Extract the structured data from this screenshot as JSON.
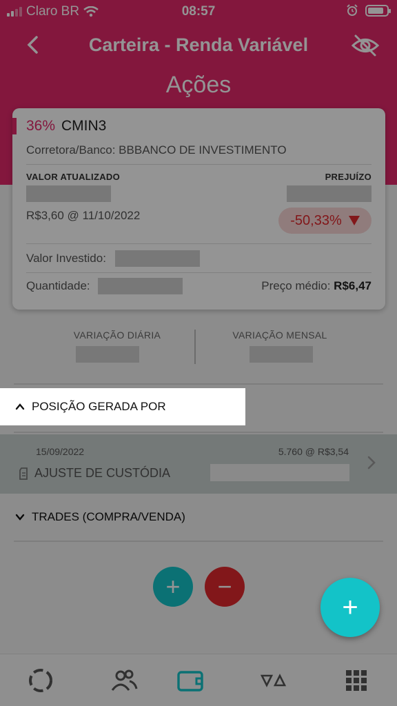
{
  "status_bar": {
    "carrier": "Claro BR",
    "time": "08:57"
  },
  "nav": {
    "title": "Carteira - Renda Variável",
    "back_icon": "chevron-left-icon",
    "visibility_icon": "eye-off-icon"
  },
  "subtitle": "Ações",
  "card": {
    "percent": "36%",
    "ticker": "CMIN3",
    "broker": "Corretora/Banco: BBBANCO DE INVESTIMENTO",
    "valor_atualizado_label": "VALOR ATUALIZADO",
    "prejuizo_label": "PREJUÍZO",
    "price_line": "R$3,60 @ 11/10/2022",
    "change": "-50,33%",
    "valor_investido_label": "Valor Investido:",
    "quantidade_label": "Quantidade:",
    "preco_medio_label": "Preço médio:",
    "preco_medio_value": "R$6,47"
  },
  "variation": {
    "daily_label": "VARIAÇÃO DIÁRIA",
    "monthly_label": "VARIAÇÃO MENSAL"
  },
  "position_section": {
    "title": "POSIÇÃO GERADA POR"
  },
  "trade_row": {
    "date": "15/09/2022",
    "qty_price": "5.760 @ R$3,54",
    "type": "AJUSTE DE CUSTÓDIA"
  },
  "trades_section": {
    "title": "TRADES (COMPRA/VENDA)"
  },
  "actions": {
    "add": "+",
    "remove": "−",
    "fab": "+"
  },
  "colors": {
    "brand": "#e2286a",
    "teal": "#13c3c8",
    "red": "#e0292d"
  },
  "tabbar": {
    "icons": [
      "loading-ring-icon",
      "users-icon",
      "wallet-icon",
      "triangles-icon",
      "grid-menu-icon"
    ],
    "active_index": 2
  }
}
